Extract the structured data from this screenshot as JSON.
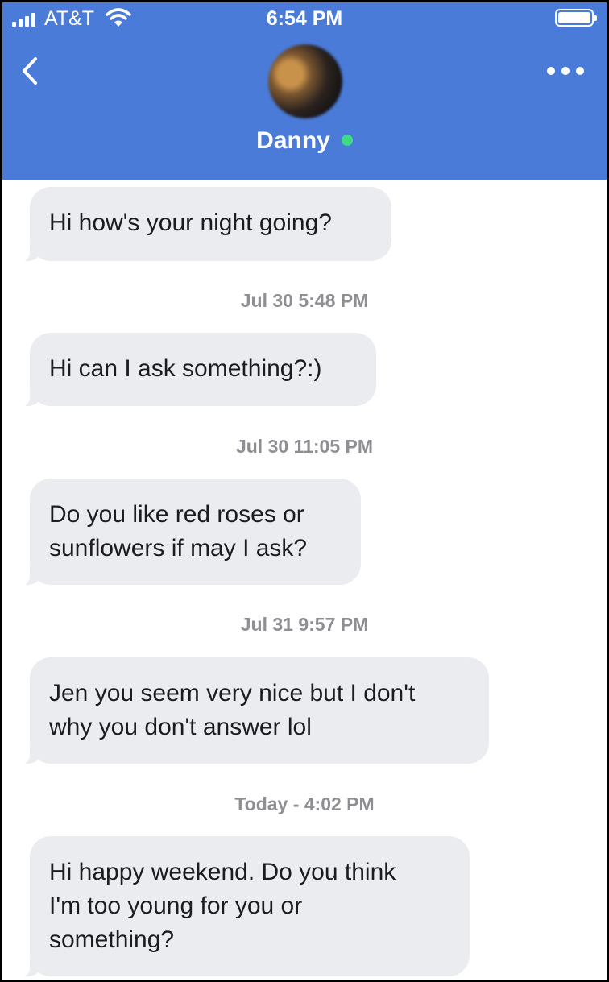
{
  "status_bar": {
    "carrier": "AT&T",
    "time": "6:54 PM",
    "signal_bars": 4,
    "battery_level": 1.0
  },
  "header": {
    "contact_name": "Danny",
    "online": true,
    "back_icon": "chevron-left-icon",
    "more_icon": "more-horizontal-icon",
    "colors": {
      "background": "#4a7bd8",
      "online_dot": "#3ddc84"
    }
  },
  "conversation": {
    "messages": [
      {
        "text": "Hi how's your night going?"
      },
      {
        "timestamp": "Jul 30 5:48 PM",
        "text": "Hi can I ask something?:)"
      },
      {
        "timestamp": "Jul 30 11:05 PM",
        "text": "Do you like red roses or\nsunflowers if may I ask?"
      },
      {
        "timestamp": "Jul 31 9:57 PM",
        "text": "Jen you seem very nice but I don't\nwhy you don't answer lol"
      },
      {
        "timestamp": "Today - 4:02 PM",
        "text": "Hi happy weekend. Do you think\nI'm too young for you or\nsomething?"
      }
    ],
    "colors": {
      "bubble": "#ebecf0",
      "timestamp": "#8e8e93"
    }
  }
}
